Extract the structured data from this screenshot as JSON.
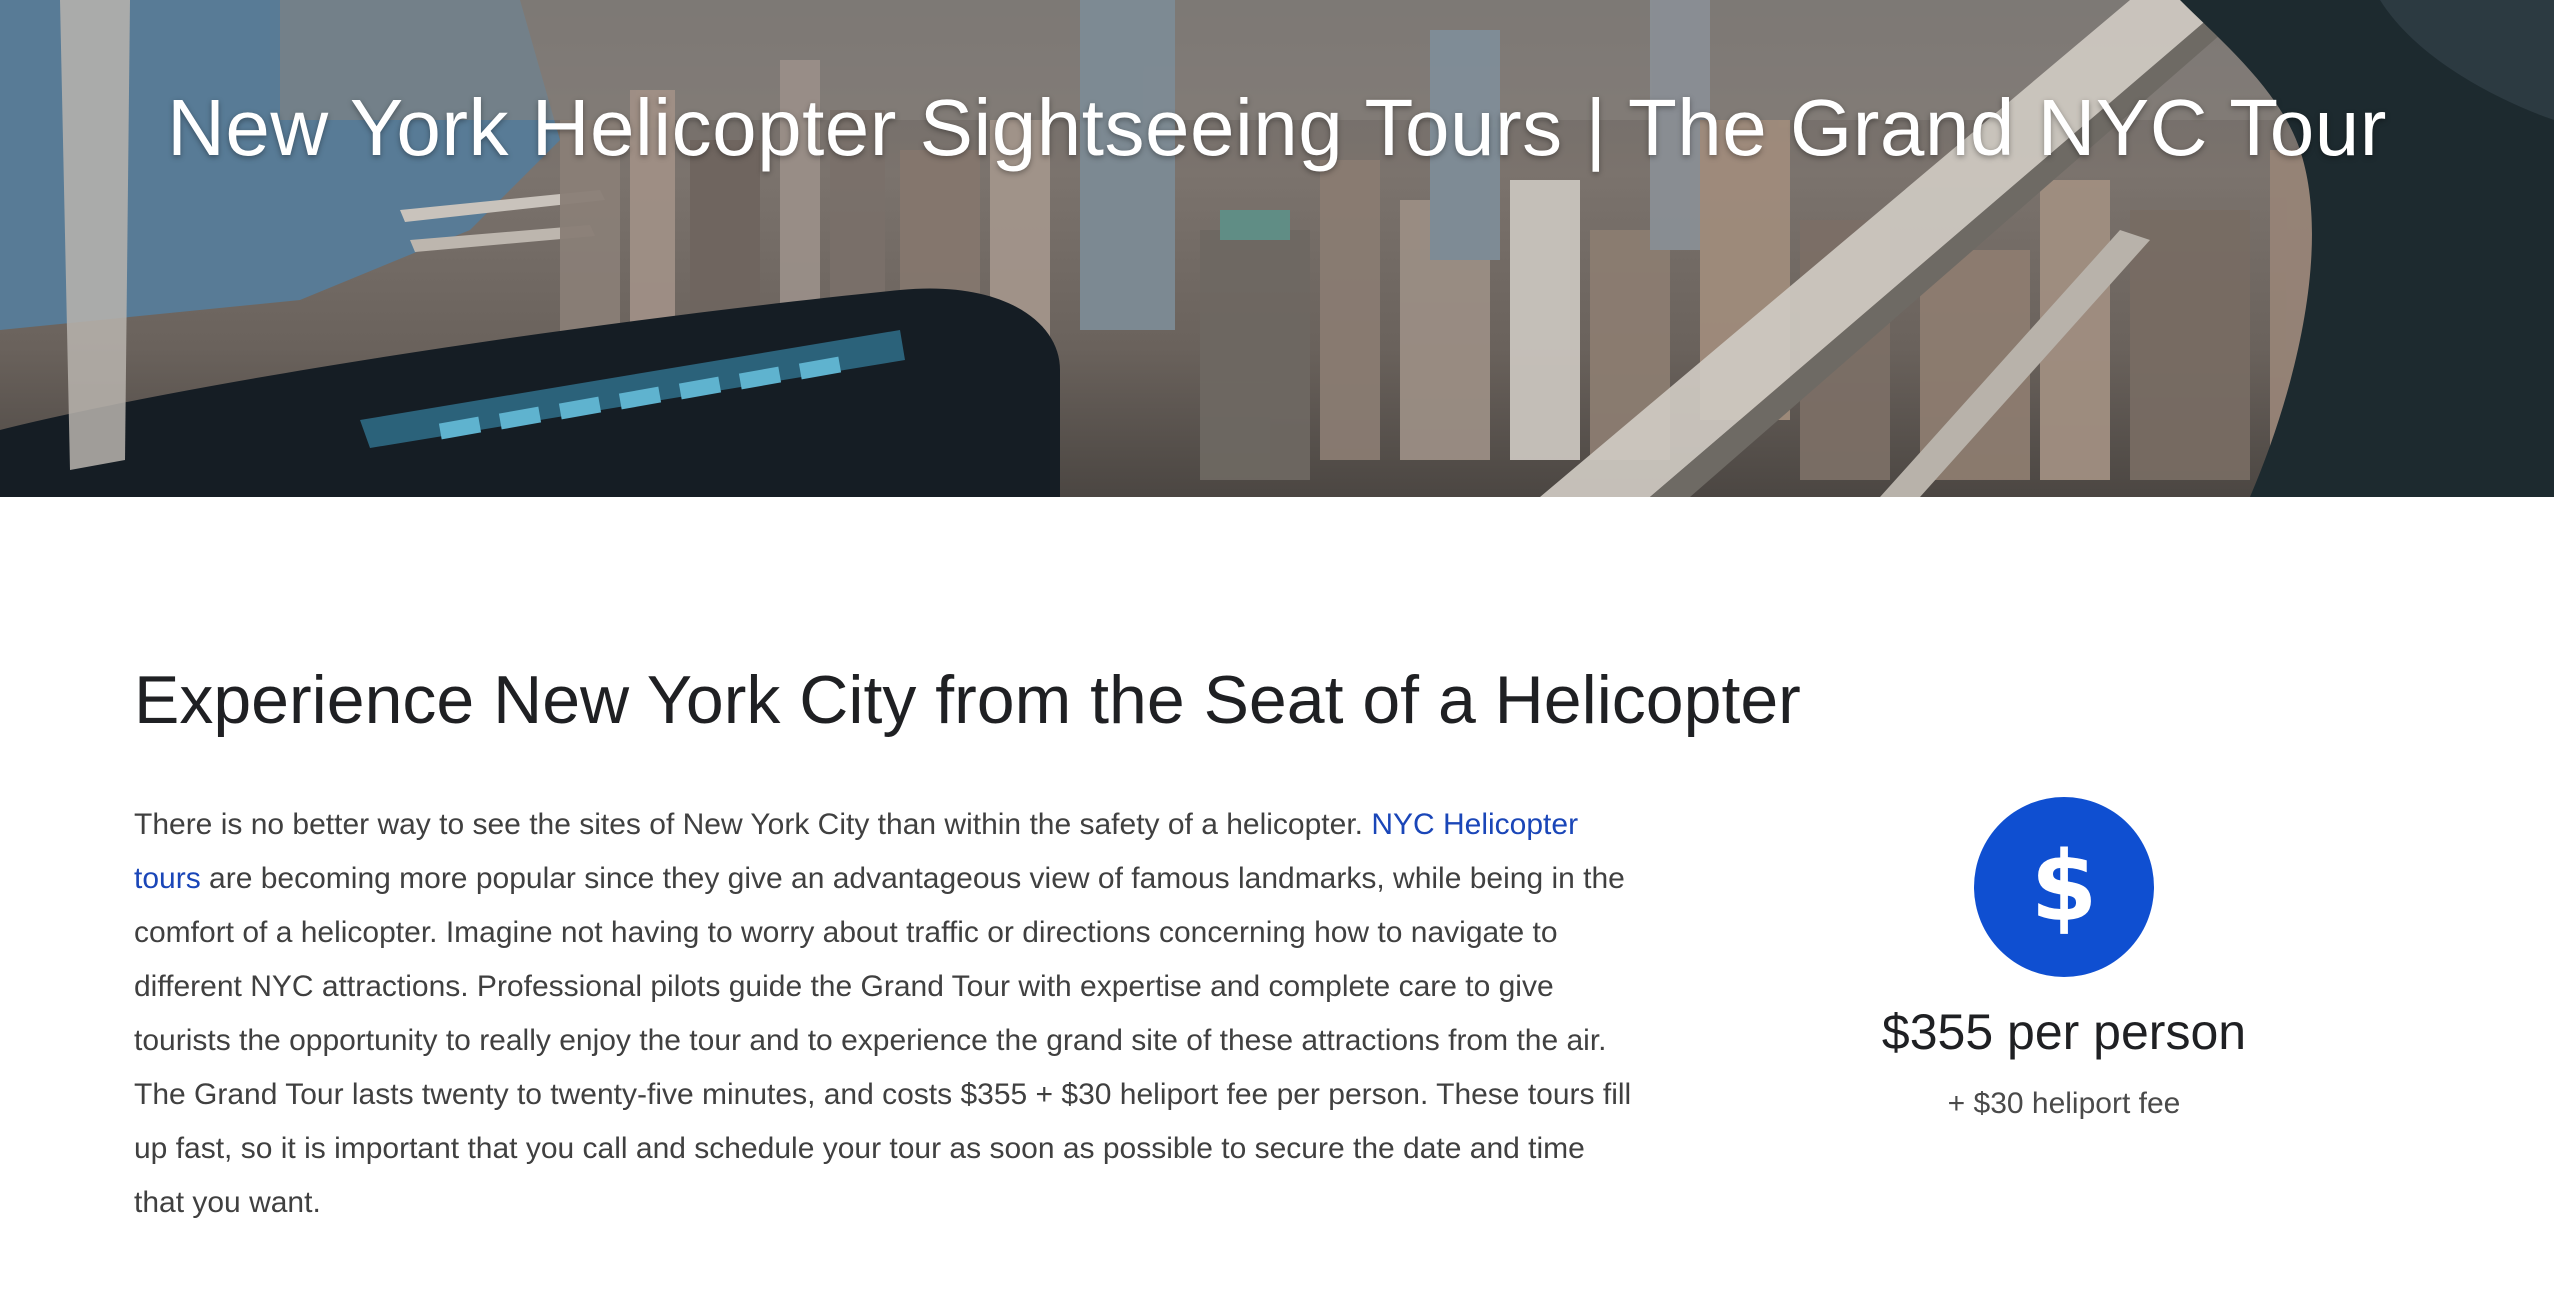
{
  "hero": {
    "title": "New York Helicopter Sightseeing Tours | The Grand NYC Tour"
  },
  "section": {
    "heading": "Experience New York City from the Seat of a Helicopter",
    "paragraph_intro": "There is no better way to see the sites of New York City than within the safety of a helicopter. ",
    "paragraph_link": "NYC Helicopter tours",
    "paragraph_rest": " are becoming more popular since they give an advantageous view of famous landmarks, while being in the comfort of a helicopter. Imagine not having to worry about traffic or directions concerning how to navigate to different NYC attractions. Professional pilots guide the Grand Tour with expertise and complete care to give tourists the opportunity to really enjoy the tour and to experience the grand site of these attractions from the air. The Grand Tour lasts twenty to twenty-five minutes, and costs $355 + $30 heliport fee per person. These tours fill up fast, so it is important that you call and schedule your tour as soon as possible to secure the date and time that you want."
  },
  "price": {
    "icon": "dollar-icon",
    "icon_glyph": "$",
    "amount": "$355 per person",
    "fee": "+ $30 heliport fee",
    "accent_color": "#0f4fd1"
  },
  "colors": {
    "link": "#1a46b8",
    "heading": "#1f2023",
    "body": "#404040"
  }
}
